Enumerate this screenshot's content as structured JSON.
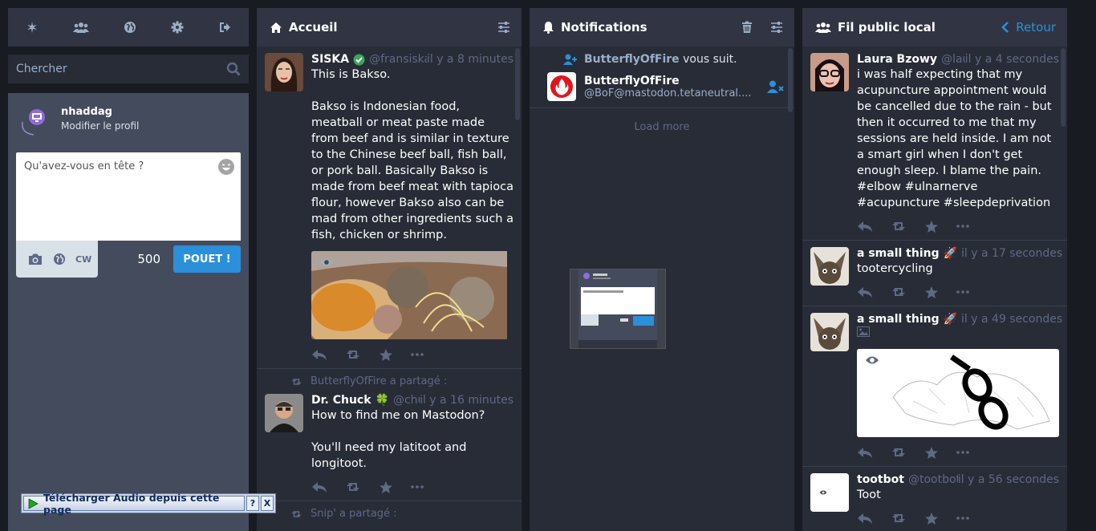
{
  "compose": {
    "search_placeholder": "Chercher",
    "username": "nhaddag",
    "edit_profile": "Modifier le profil",
    "textarea_placeholder": "Qu'avez-vous en tête ?",
    "cw_label": "CW",
    "char_count": "500",
    "toot_button": "POUET !"
  },
  "home": {
    "title": "Accueil",
    "statuses": [
      {
        "display_name": "SISKA",
        "acct": "@fransiska...",
        "time": "il y a 8 minutes",
        "paragraphs": [
          "This is Bakso.",
          "Bakso is Indonesian food, meatball or meat paste made from beef and is similar in texture to the Chinese beef ball, fish ball, or pork ball. Basically Bakso is made from beef meat with tapioca flour, however Bakso also can be mad from other ingredients such a fish, chicken or shrimp."
        ]
      },
      {
        "reblog_by": "ButterflyOfFire a partagé :",
        "display_name": "Dr. Chuck",
        "emoji": "🍀",
        "acct": "@chuc...",
        "time": "il y a 16 minutes",
        "paragraphs": [
          "How to find me on Mastodon?",
          "You'll need my latitoot and longitoot."
        ]
      }
    ],
    "next_reblog": "Snip' a partagé :"
  },
  "notifications": {
    "title": "Notifications",
    "follow_name": "ButterflyOfFire",
    "follow_text": "vous suit.",
    "card_name": "ButterflyOfFire",
    "card_handle": "@BoF@mastodon.tetaneutral....",
    "load_more": "Load more"
  },
  "public": {
    "title": "Fil public local",
    "back": "Retour",
    "statuses": [
      {
        "display_name": "Laura Bzowy",
        "acct": "@laura...",
        "time": "il y a 4 secondes",
        "text": "i was half expecting that my acupuncture appointment would be cancelled due to the rain  - but then it occurred to me that my sessions are held inside.  I am not a smart girl when I don't get enough sleep. I blame the pain. #elbow #ulnarnerve #acupuncture #sleepdeprivation"
      },
      {
        "display_name": "a small thing",
        "emoji": "🚀",
        "acct": "@...",
        "time": "il y a 17 secondes",
        "text": "tootercycling"
      },
      {
        "display_name": "a small thing",
        "emoji": "🚀",
        "acct": "@...",
        "time": "il y a 49 secondes",
        "text": ""
      },
      {
        "display_name": "tootbot",
        "acct": "@tootbot",
        "time": "il y a 56 secondes",
        "text": "Toot"
      }
    ]
  },
  "addon": {
    "label": "Télécharger Audio depuis cette page",
    "help": "?",
    "close": "X"
  },
  "colors": {
    "bg": "#191b22",
    "column": "#282c37",
    "header": "#313543",
    "accent": "#2b90d9",
    "muted": "#606984"
  }
}
